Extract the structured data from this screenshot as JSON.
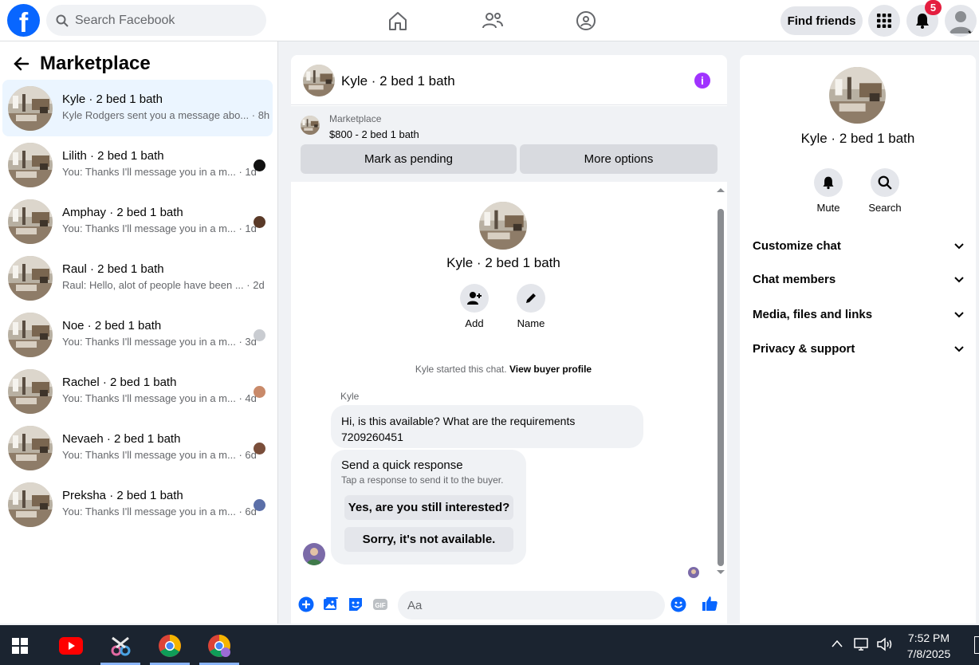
{
  "topbar": {
    "logo": "f",
    "search_placeholder": "Search Facebook",
    "find_friends": "Find friends",
    "notification_count": "5",
    "icons": [
      "home-icon",
      "friends-icon",
      "groups-icon",
      "menu-grid-icon",
      "bell-icon"
    ]
  },
  "left": {
    "title": "Marketplace",
    "conversations": [
      {
        "title": "Kyle · 2 bed 1 bath",
        "snippet": "Kyle Rodgers sent you a message abo...",
        "time": "8h",
        "active": true,
        "dot": ""
      },
      {
        "title": "Lilith · 2 bed 1 bath",
        "snippet": "You: Thanks I'll message you in a m...",
        "time": "1d",
        "dot": "#111111"
      },
      {
        "title": "Amphay · 2 bed 1 bath",
        "snippet": "You: Thanks I'll message you in a m...",
        "time": "1d",
        "dot": "#5a3a28"
      },
      {
        "title": "Raul · 2 bed 1 bath",
        "snippet": "Raul: Hello, alot of people have been ...",
        "time": "2d",
        "dot": ""
      },
      {
        "title": "Noe · 2 bed 1 bath",
        "snippet": "You: Thanks I'll message you in a m...",
        "time": "3d",
        "dot": "#c9ccd1"
      },
      {
        "title": "Rachel · 2 bed 1 bath",
        "snippet": "You: Thanks I'll message you in a m...",
        "time": "4d",
        "dot": "#c98a6a"
      },
      {
        "title": "Nevaeh · 2 bed 1 bath",
        "snippet": "You: Thanks I'll message you in a m...",
        "time": "6d",
        "dot": "#7a4e3a"
      },
      {
        "title": "Preksha · 2 bed 1 bath",
        "snippet": "You: Thanks I'll message you in a m...",
        "time": "6d",
        "dot": "#5b6fa8"
      }
    ]
  },
  "chat": {
    "title": "Kyle · 2 bed 1 bath",
    "marketplace_label": "Marketplace",
    "listing": "$800 - 2 bed 1 bath",
    "mark_pending": "Mark as pending",
    "more_options": "More options",
    "profile_name": "Kyle · 2 bed 1 bath",
    "add_label": "Add",
    "name_label": "Name",
    "started_text": "Kyle started this chat.",
    "view_buyer": "View buyer profile",
    "sender": "Kyle",
    "message": "Hi, is this available? What are the requirements 7209260451",
    "quick_title": "Send a quick response",
    "quick_sub": "Tap a response to send it to the buyer.",
    "quick_1": "Yes, are you still interested?",
    "quick_2": "Sorry, it's not available.",
    "input_placeholder": "Aa"
  },
  "details": {
    "name": "Kyle · 2 bed 1 bath",
    "mute": "Mute",
    "search": "Search",
    "sections": [
      "Customize chat",
      "Chat members",
      "Media, files and links",
      "Privacy & support"
    ]
  },
  "taskbar": {
    "time": "7:52 PM",
    "date": "7/8/2025"
  },
  "colors": {
    "brand": "#0866ff",
    "accent_purple": "#a033ff",
    "badge": "#e41e3f"
  }
}
